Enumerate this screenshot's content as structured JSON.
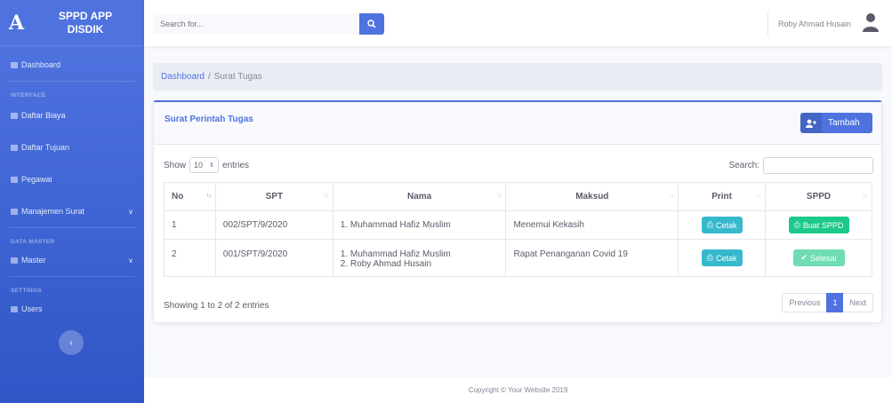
{
  "brand": {
    "logo": "A",
    "line1": "SPPD APP",
    "line2": "DISDIK"
  },
  "sidebar": {
    "dashboard": "Dashboard",
    "section_interface": "INTERFACE",
    "daftar_biaya": "Daftar Biaya",
    "daftar_tujuan": "Daftar Tujuan",
    "pegawai": "Pegawai",
    "manajemen_surat": "Manajemen Surat",
    "section_data_master": "DATA MASTER",
    "master": "Master",
    "section_settings": "SETTINGS",
    "users": "Users",
    "toggle": "‹"
  },
  "topbar": {
    "search_placeholder": "Search for...",
    "user_name": "Roby Ahmad Husain"
  },
  "breadcrumb": {
    "home": "Dashboard",
    "separator": "/",
    "current": "Surat Tugas"
  },
  "card": {
    "title": "Surat Perintah Tugas",
    "add_label": "Tambah",
    "show_label": "Show",
    "entries_value": "10",
    "entries_label": "entries",
    "search_label": "Search:",
    "columns": [
      "No",
      "SPT",
      "Nama",
      "Maksud",
      "Print",
      "SPPD"
    ],
    "rows": [
      {
        "no": "1",
        "spt": "002/SPT/9/2020",
        "nama": [
          "1. Muhammad Hafiz Muslim"
        ],
        "maksud": "Menemui Kekasih",
        "print": "Cetak",
        "sppd": "Buat SPPD"
      },
      {
        "no": "2",
        "spt": "001/SPT/9/2020",
        "nama": [
          "1. Muhammad Hafiz Muslim",
          "2. Roby Ahmad Husain"
        ],
        "maksud": "Rapat Penanganan Covid 19",
        "print": "Cetak",
        "sppd": "Selesai"
      }
    ],
    "info": "Showing 1 to 2 of 2 entries",
    "pager": {
      "previous": "Previous",
      "page": "1",
      "next": "Next"
    }
  },
  "footer": {
    "text": "Copyright © Your Website 2019"
  },
  "colors": {
    "primary": "#4e73df",
    "info": "#36b9cc",
    "success": "#1cc88a"
  }
}
